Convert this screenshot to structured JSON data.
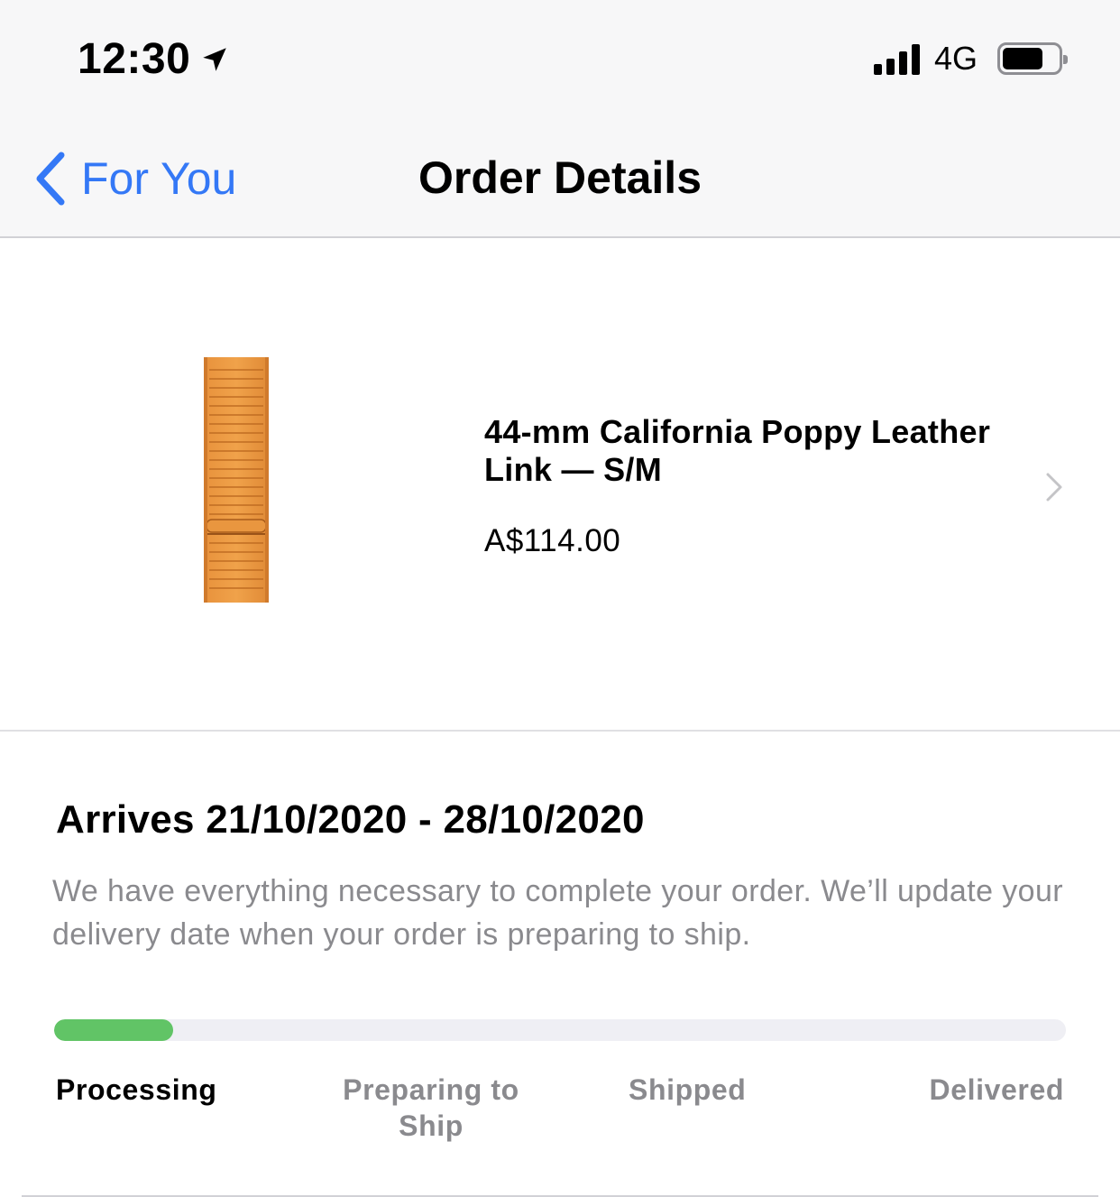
{
  "status_bar": {
    "time": "12:30",
    "location_icon": "location-arrow-icon",
    "network": "4G",
    "signal_icon": "cellular-signal-icon",
    "battery_icon": "battery-icon"
  },
  "nav": {
    "back_label": "For You",
    "back_icon": "chevron-left-icon",
    "title": "Order Details",
    "accent_color": "#3478f6"
  },
  "product": {
    "name": "44-mm California Poppy Leather Link — S/M",
    "price": "A$114.00",
    "image": "leather-link-strap-image",
    "chevron_icon": "chevron-right-icon"
  },
  "delivery": {
    "arrives": "Arrives 21/10/2020 - 28/10/2020",
    "description": "We have everything necessary to complete your order. We’ll update your delivery date when your order is preparing to ship."
  },
  "progress": {
    "fraction": 0.118,
    "bar_color": "#61c466",
    "steps": [
      {
        "label": "Processing",
        "active": true
      },
      {
        "label": "Preparing to Ship",
        "active": false
      },
      {
        "label": "Shipped",
        "active": false
      },
      {
        "label": "Delivered",
        "active": false
      }
    ]
  }
}
